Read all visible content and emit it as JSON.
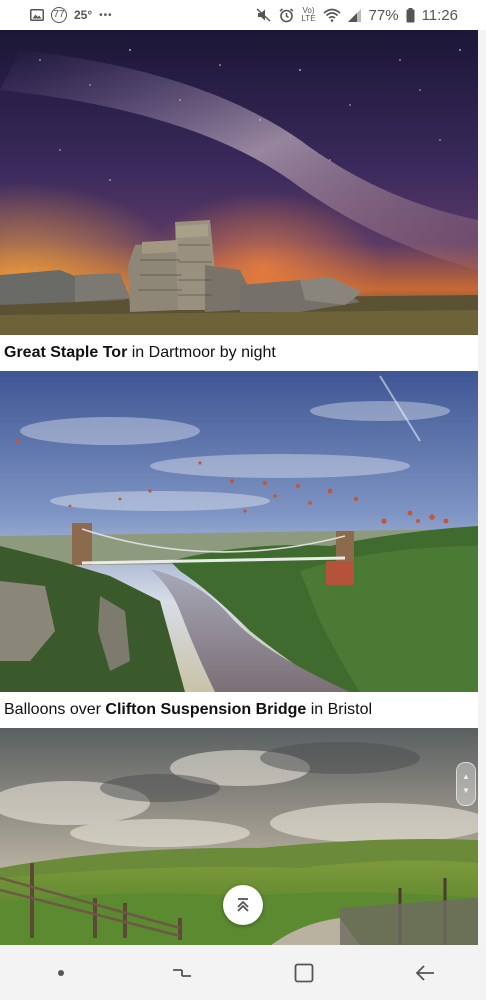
{
  "status_bar": {
    "notification_badge": "77",
    "temperature": "25°",
    "more_dots": "•••",
    "lte_label": "Vo)\nLTE",
    "battery_percent": "77%",
    "time": "11:26"
  },
  "articles": [
    {
      "image_description": "milky-way-over-rock-tor",
      "caption_before": "",
      "caption_bold": "Great Staple Tor",
      "caption_after": " in Dartmoor by night"
    },
    {
      "image_description": "balloons-over-suspension-bridge",
      "caption_before": "Balloons over ",
      "caption_bold": "Clifton Suspension Bridge",
      "caption_after": " in Bristol"
    },
    {
      "image_description": "green-hills-under-stormy-sky",
      "caption_before": "",
      "caption_bold": "",
      "caption_after": ""
    }
  ],
  "icons": {
    "scroll_to_top": "double-chevron-up-icon",
    "nav": [
      "recents-icon",
      "home-icon",
      "back-icon"
    ]
  }
}
